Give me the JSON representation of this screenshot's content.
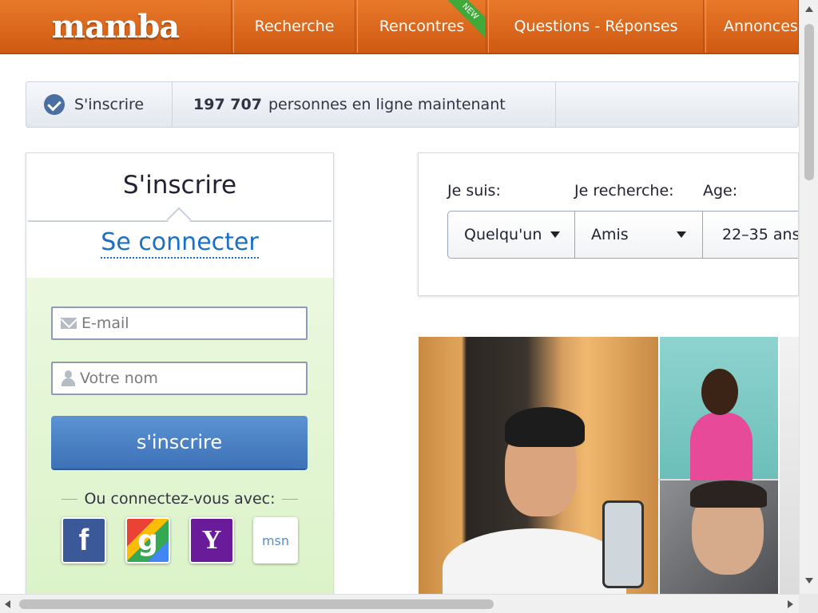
{
  "brand": {
    "logo": "mamba"
  },
  "nav": {
    "items": [
      "Recherche",
      "Rencontres",
      "Questions - Réponses",
      "Annonces"
    ],
    "new_badge": "NEW"
  },
  "status": {
    "signup_label": "S'inscrire",
    "online_count": "197 707",
    "online_text": "personnes en ligne maintenant"
  },
  "signup_panel": {
    "title": "S'inscrire",
    "login_link": "Se connecter",
    "email_placeholder": "E-mail",
    "name_placeholder": "Votre nom",
    "submit_label": "s'inscrire",
    "social_label": "Ou connectez-vous avec:",
    "social": [
      {
        "name": "facebook",
        "glyph": "f",
        "color": "#3b5998"
      },
      {
        "name": "google",
        "glyph": "g",
        "color": "#34a853"
      },
      {
        "name": "yahoo",
        "glyph": "Y",
        "color": "#6a1b9a"
      },
      {
        "name": "msn",
        "glyph": "msn",
        "color": "#5a8dc5"
      }
    ]
  },
  "search": {
    "i_am_label": "Je suis:",
    "i_am_value": "Quelqu'un",
    "seeking_label": "Je recherche:",
    "seeking_value": "Amis",
    "age_label": "Age:",
    "age_value": "22–35 ans"
  },
  "colors": {
    "nav_orange": "#d9661a",
    "link_blue": "#1a6fc7",
    "button_blue": "#4a82c6",
    "form_green": "#e2f6d1"
  }
}
